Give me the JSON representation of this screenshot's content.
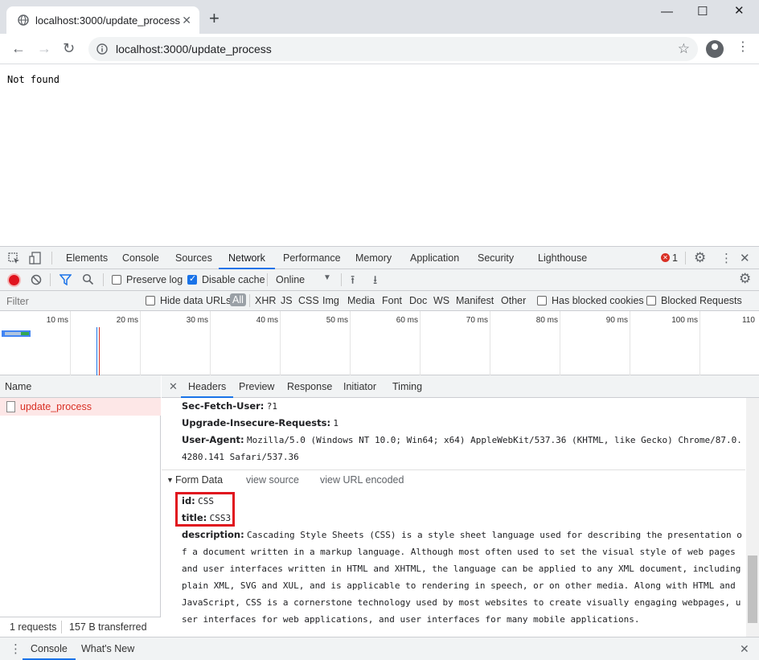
{
  "browser": {
    "tab_title": "localhost:3000/update_process",
    "new_tab": "+",
    "url": "localhost:3000/update_process"
  },
  "page": {
    "body_text": "Not found"
  },
  "devtools": {
    "tabs": [
      "Elements",
      "Console",
      "Sources",
      "Network",
      "Performance",
      "Memory",
      "Application",
      "Security",
      "Lighthouse"
    ],
    "active_tab": "Network",
    "error_count": "1",
    "toolbar": {
      "preserve_log": "Preserve log",
      "disable_cache": "Disable cache",
      "throttle": "Online"
    },
    "filter": {
      "placeholder": "Filter",
      "hide_data_urls": "Hide data URLs",
      "types": [
        "All",
        "XHR",
        "JS",
        "CSS",
        "Img",
        "Media",
        "Font",
        "Doc",
        "WS",
        "Manifest",
        "Other"
      ],
      "has_blocked_cookies": "Has blocked cookies",
      "blocked_requests": "Blocked Requests"
    },
    "timeline_ticks": [
      "10 ms",
      "20 ms",
      "30 ms",
      "40 ms",
      "50 ms",
      "60 ms",
      "70 ms",
      "80 ms",
      "90 ms",
      "100 ms",
      "110"
    ],
    "request_list": {
      "header": "Name",
      "requests": [
        "update_process"
      ],
      "status_requests": "1 requests",
      "status_transferred": "157 B transferred"
    },
    "detail_tabs": [
      "Headers",
      "Preview",
      "Response",
      "Initiator",
      "Timing"
    ],
    "headers": {
      "sec_fetch_user_k": "Sec-Fetch-User:",
      "sec_fetch_user_v": "?1",
      "upgrade_k": "Upgrade-Insecure-Requests:",
      "upgrade_v": "1",
      "ua_k": "User-Agent:",
      "ua_v": "Mozilla/5.0 (Windows NT 10.0; Win64; x64) AppleWebKit/537.36 (KHTML, like Gecko) Chrome/87.0.4280.141 Safari/537.36"
    },
    "form_data": {
      "title": "Form Data",
      "view_source": "view source",
      "view_url_encoded": "view URL encoded",
      "id_k": "id:",
      "id_v": "CSS",
      "title_k": "title:",
      "title_v": "CSS3",
      "desc_k": "description:",
      "desc_v": "Cascading Style Sheets (CSS) is a style sheet language used for describing the presentation of a document written in a markup language. Although most often used to set the visual style of web pages and user interfaces written in HTML and XHTML, the language can be applied to any XML document, including plain XML, SVG and XUL, and is applicable to rendering in speech, or on other media. Along with HTML and JavaScript, CSS is a cornerstone technology used by most websites to create visually engaging webpages, user interfaces for web applications, and user interfaces for many mobile applications."
    },
    "drawer": {
      "console": "Console",
      "whats_new": "What's New"
    }
  }
}
